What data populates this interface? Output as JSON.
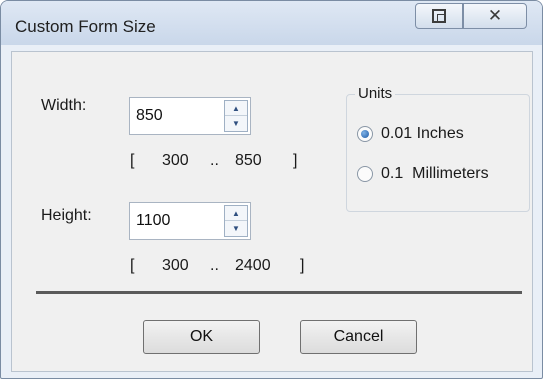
{
  "window": {
    "title": "Custom Form Size",
    "close_glyph": "✕"
  },
  "width": {
    "label": "Width:",
    "value": "850",
    "range_open": "[",
    "range_min": "300",
    "range_sep": "..",
    "range_max": "850",
    "range_close": "]"
  },
  "height": {
    "label": "Height:",
    "value": "1100",
    "range_open": "[",
    "range_min": "300",
    "range_sep": "..",
    "range_max": "2400",
    "range_close": "]"
  },
  "units": {
    "title": "Units",
    "options": [
      {
        "label": "0.01 Inches",
        "checked": true
      },
      {
        "label": "0.1  Millimeters",
        "checked": false
      }
    ]
  },
  "buttons": {
    "ok": "OK",
    "cancel": "Cancel"
  },
  "icons": {
    "restore": "restore-icon",
    "close": "close-icon",
    "spin_up": "▲",
    "spin_down": "▼"
  }
}
